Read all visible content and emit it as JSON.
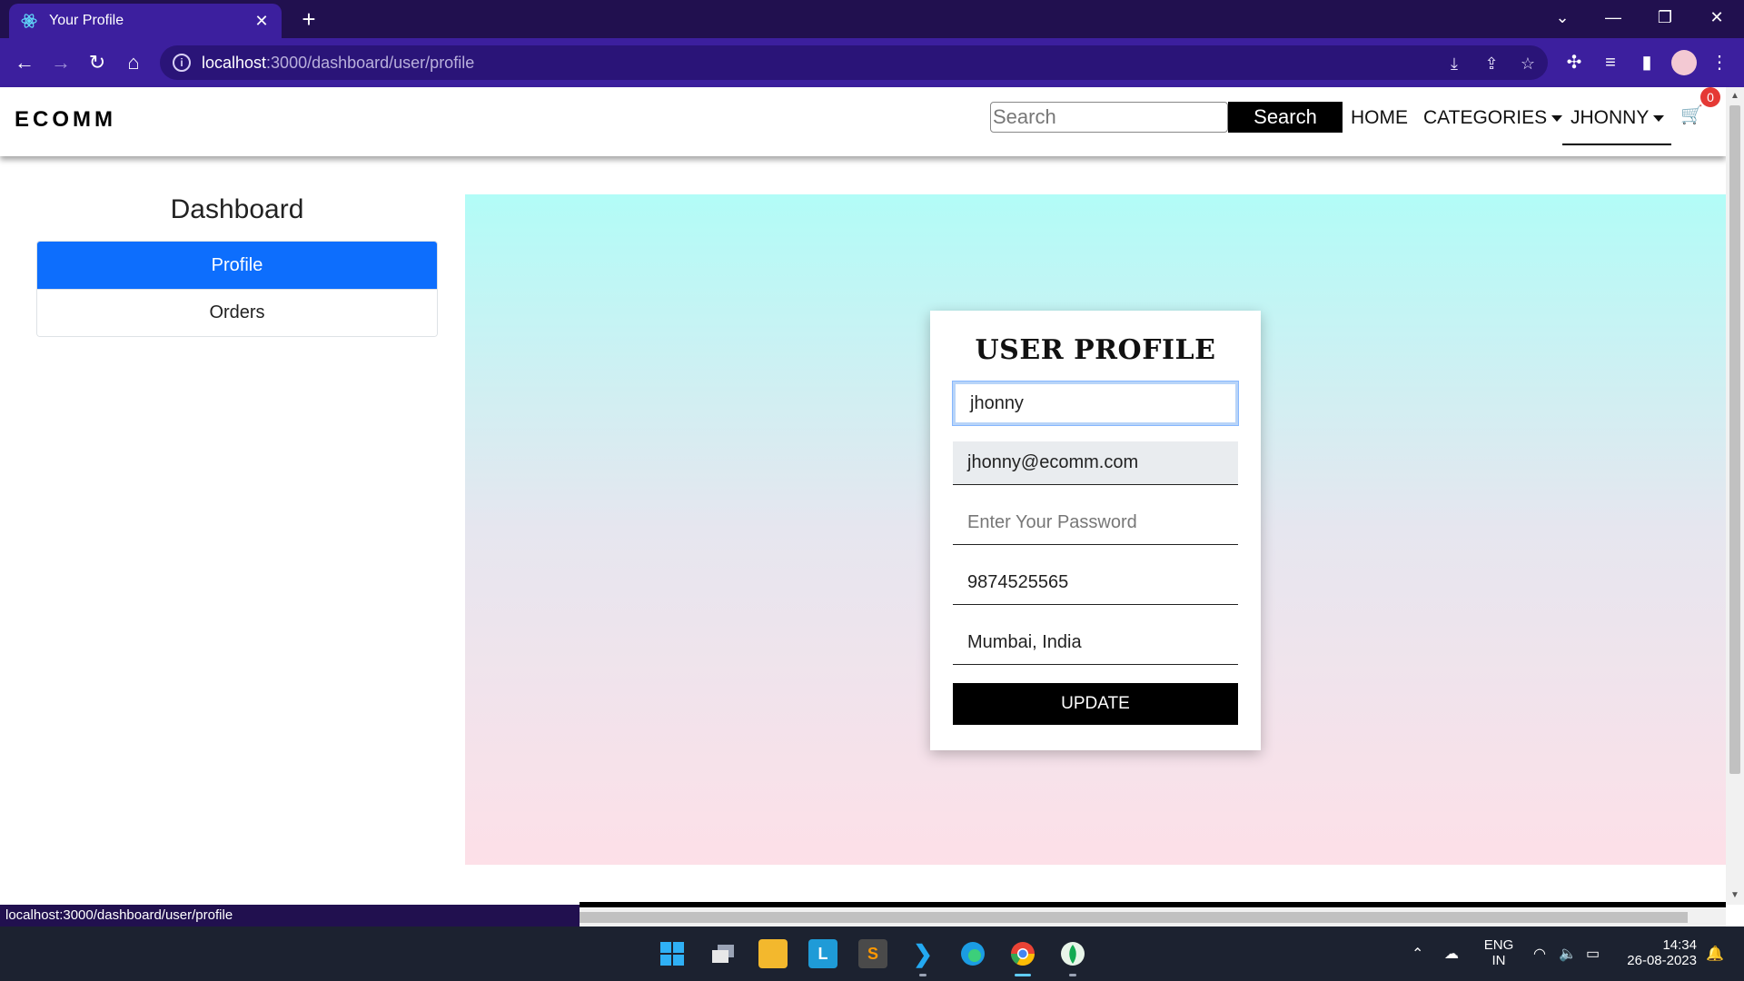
{
  "browser": {
    "tab_title": "Your Profile",
    "url_host": "localhost",
    "url_path": ":3000/dashboard/user/profile",
    "status_url": "localhost:3000/dashboard/user/profile"
  },
  "site": {
    "brand": "ECOMM",
    "search_placeholder": "Search",
    "search_button": "Search",
    "nav": {
      "home": "HOME",
      "categories": "CATEGORIES",
      "user": "JHONNY"
    },
    "cart_count": "0"
  },
  "sidebar": {
    "title": "Dashboard",
    "items": [
      {
        "label": "Profile",
        "active": true
      },
      {
        "label": "Orders",
        "active": false
      }
    ]
  },
  "profile_form": {
    "title": "USER PROFILE",
    "name_value": "jhonny",
    "email_value": "jhonny@ecomm.com",
    "password_placeholder": "Enter Your Password",
    "phone_value": "9874525565",
    "address_value": "Mumbai, India",
    "update_button": "UPDATE"
  },
  "taskbar": {
    "lang_line1": "ENG",
    "lang_line2": "IN",
    "time": "14:34",
    "date": "26-08-2023"
  },
  "colors": {
    "browser_frame": "#21104f",
    "browser_toolbar": "#3c1f9e",
    "active_menu": "#0d6efd",
    "gradient_top": "#b2fcf7",
    "gradient_bottom": "#fde0e8",
    "cart_badge": "#e53935"
  }
}
